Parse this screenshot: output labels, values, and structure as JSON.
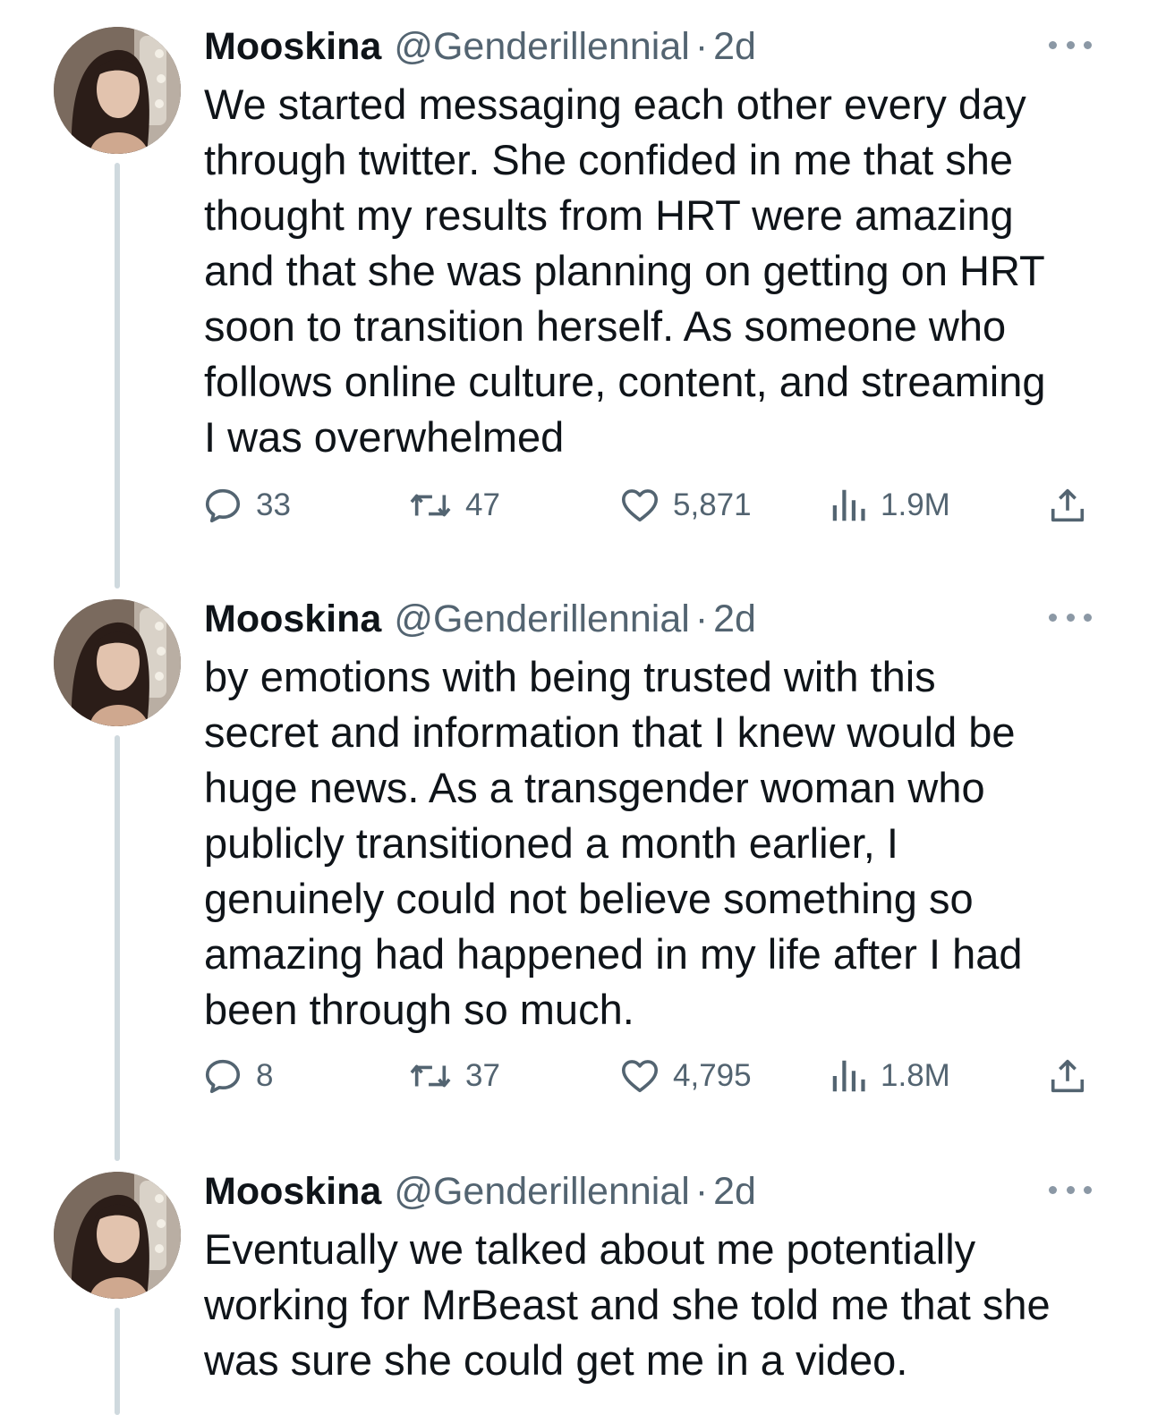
{
  "tweets": [
    {
      "author_name": "Mooskina",
      "handle": "@Genderillennial",
      "separator": "·",
      "time": "2d",
      "text_lines": [
        "We started messaging each other every day",
        "through twitter. She confided in me that she",
        "thought my results from HRT were amazing",
        "and that she was planning on getting on HRT",
        "soon to transition herself. As someone who",
        "follows online culture, content, and streaming",
        "I was overwhelmed"
      ],
      "replies": "33",
      "retweets": "47",
      "likes": "5,871",
      "views": "1.9M"
    },
    {
      "author_name": "Mooskina",
      "handle": "@Genderillennial",
      "separator": "·",
      "time": "2d",
      "text_lines": [
        "by emotions with being trusted with this",
        "secret and information that I knew would be",
        "huge news. As a transgender woman who",
        "publicly transitioned a month earlier, I",
        "genuinely could not believe something so",
        "amazing had happened in my life after I had",
        "been through so much."
      ],
      "replies": "8",
      "retweets": "37",
      "likes": "4,795",
      "views": "1.8M"
    },
    {
      "author_name": "Mooskina",
      "handle": "@Genderillennial",
      "separator": "·",
      "time": "2d",
      "text_lines": [
        "Eventually we talked about me potentially",
        "working for MrBeast and she told me that she",
        "was sure she could get me in a video."
      ]
    }
  ],
  "icons": {
    "reply": "reply-icon",
    "retweet": "retweet-icon",
    "like": "heart-icon",
    "views": "views-chart-icon",
    "share": "share-icon",
    "more": "more-dots-icon"
  },
  "colors": {
    "text": "#0f1419",
    "secondary": "#536471",
    "thread_line": "#cfd9de"
  }
}
